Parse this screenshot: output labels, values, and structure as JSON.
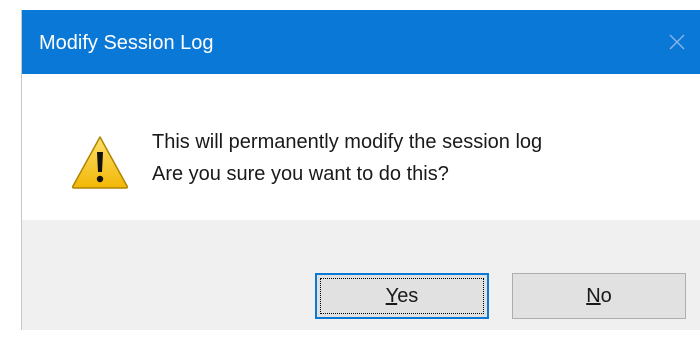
{
  "dialog": {
    "title": "Modify Session Log",
    "close_icon": "close-icon",
    "warning_icon": "warning-icon",
    "message_lines": [
      "This will permanently modify the session log",
      "Are you sure you want to do this?"
    ],
    "buttons": {
      "yes": {
        "accel": "Y",
        "rest": "es"
      },
      "no": {
        "accel": "N",
        "rest": "o"
      }
    },
    "colors": {
      "titlebar": "#0a78d7",
      "footer": "#f0f0f0",
      "button_face": "#e1e1e1",
      "default_button_border": "#0a78d7",
      "warning_fill": "#f5c211"
    }
  }
}
